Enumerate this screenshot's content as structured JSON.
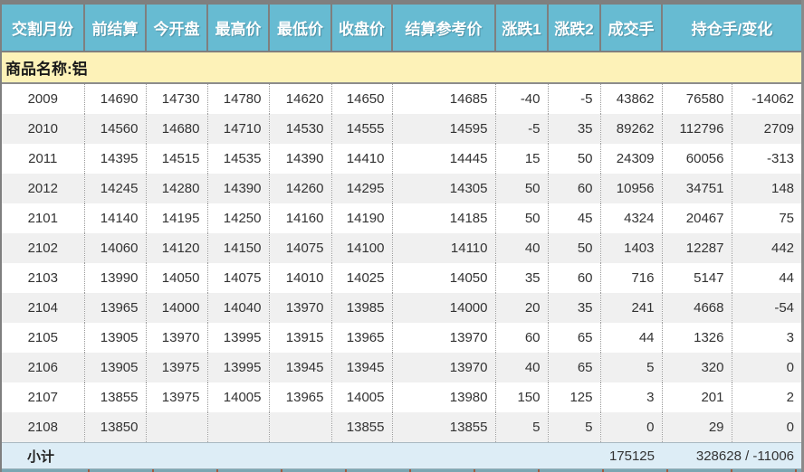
{
  "table": {
    "headers": [
      "交割月份",
      "前结算",
      "今开盘",
      "最高价",
      "最低价",
      "收盘价",
      "结算参考价",
      "涨跌1",
      "涨跌2",
      "成交手",
      "持仓手/变化"
    ],
    "column_keys": [
      "delivery-month",
      "prev-settle",
      "open",
      "high",
      "low",
      "close",
      "settle-ref",
      "change1",
      "change2",
      "volume",
      "open-interest",
      "oi-change"
    ],
    "product_label": "商品名称:铝",
    "rows": [
      [
        "2009",
        "14690",
        "14730",
        "14780",
        "14620",
        "14650",
        "14685",
        "-40",
        "-5",
        "43862",
        "76580",
        "-14062"
      ],
      [
        "2010",
        "14560",
        "14680",
        "14710",
        "14530",
        "14555",
        "14595",
        "-5",
        "35",
        "89262",
        "112796",
        "2709"
      ],
      [
        "2011",
        "14395",
        "14515",
        "14535",
        "14390",
        "14410",
        "14445",
        "15",
        "50",
        "24309",
        "60056",
        "-313"
      ],
      [
        "2012",
        "14245",
        "14280",
        "14390",
        "14260",
        "14295",
        "14305",
        "50",
        "60",
        "10956",
        "34751",
        "148"
      ],
      [
        "2101",
        "14140",
        "14195",
        "14250",
        "14160",
        "14190",
        "14185",
        "50",
        "45",
        "4324",
        "20467",
        "75"
      ],
      [
        "2102",
        "14060",
        "14120",
        "14150",
        "14075",
        "14100",
        "14110",
        "40",
        "50",
        "1403",
        "12287",
        "442"
      ],
      [
        "2103",
        "13990",
        "14050",
        "14075",
        "14010",
        "14025",
        "14050",
        "35",
        "60",
        "716",
        "5147",
        "44"
      ],
      [
        "2104",
        "13965",
        "14000",
        "14040",
        "13970",
        "13985",
        "14000",
        "20",
        "35",
        "241",
        "4668",
        "-54"
      ],
      [
        "2105",
        "13905",
        "13970",
        "13995",
        "13915",
        "13965",
        "13970",
        "60",
        "65",
        "44",
        "1326",
        "3"
      ],
      [
        "2106",
        "13905",
        "13975",
        "13995",
        "13945",
        "13945",
        "13970",
        "40",
        "65",
        "5",
        "320",
        "0"
      ],
      [
        "2107",
        "13855",
        "13975",
        "14005",
        "13965",
        "14005",
        "13980",
        "150",
        "125",
        "3",
        "201",
        "2"
      ],
      [
        "2108",
        "13850",
        "",
        "",
        "",
        "13855",
        "13855",
        "5",
        "5",
        "0",
        "29",
        "0"
      ]
    ],
    "subtotal": {
      "label": "小计",
      "volume": "175125",
      "oi_and_change": "328628 / -11006"
    }
  },
  "colors": {
    "header_bg": "#67bbd2",
    "header_text": "#ffffff",
    "product_row_bg": "#fdf2b8",
    "row_alt_bg": "#f0f0f0",
    "subtotal_bg": "#ddedf6",
    "border_gray": "#7f7f7f",
    "dotted_divider": "#999999",
    "data_text": "#333333"
  }
}
